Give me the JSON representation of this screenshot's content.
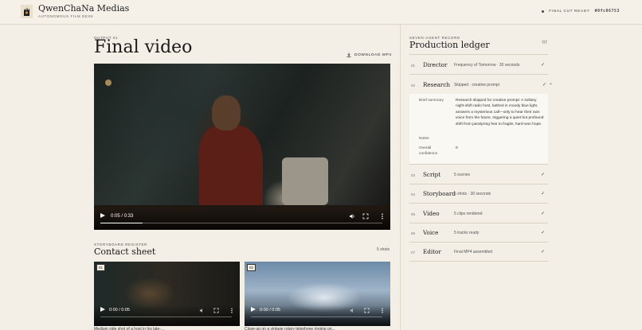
{
  "header": {
    "brand_name": "QwenChaNa Medias",
    "brand_sub": "AUTONOMOUS FILM DESK",
    "status_text": "FINAL CUT READY",
    "status_hash": "#0fc06753"
  },
  "output": {
    "eyebrow": "OUTPUT 01",
    "title": "Final video",
    "download_label": "DOWNLOAD MP4",
    "player": {
      "time": "0:05 / 0:33",
      "progress": 0.15
    }
  },
  "storyboard": {
    "eyebrow": "STORYBOARD REGISTER",
    "title": "Contact sheet",
    "count": "5 shots",
    "thumbs": [
      {
        "num": "01",
        "time": "0:00 / 0:05",
        "caption": "Medium side shot of a host in his late-..."
      },
      {
        "num": "02",
        "time": "0:00 / 0:05",
        "caption": "Close-up on a vintage rotary telephone ringing on..."
      }
    ]
  },
  "ledger": {
    "eyebrow": "SEVEN-AGENT RECORD",
    "title": "Production ledger",
    "count": "7/7",
    "rows": [
      {
        "num": "01",
        "name": "Director",
        "status": "Frequency of Tomorrow · 30 seconds"
      },
      {
        "num": "02",
        "name": "Research",
        "status": "Skipped · creative prompt"
      },
      {
        "num": "03",
        "name": "Script",
        "status": "5 scenes"
      },
      {
        "num": "04",
        "name": "Storyboard",
        "status": "5 shots · 30 seconds"
      },
      {
        "num": "05",
        "name": "Video",
        "status": "5 clips rendered"
      },
      {
        "num": "06",
        "name": "Voice",
        "status": "5 tracks ready"
      },
      {
        "num": "07",
        "name": "Editor",
        "status": "Final MP4 assembled"
      }
    ],
    "detail": {
      "summary_label": "Brief summary",
      "summary_text": "Research skipped for creative prompt: A solitary night-shift radio host, bathed in moody blue light, answers a mysterious call—only to hear their own voice from the future, triggering a quiet but profound shift from paralyzing fear to fragile, hard-won hope.",
      "notes_label": "Notes",
      "confidence_label": "Overall confidence",
      "confidence_value": "0"
    }
  },
  "icons": {
    "check": "✓",
    "chevron_up": "⌃",
    "volume": "speaker-icon",
    "fullscreen": "fullscreen-icon",
    "more": "more-icon"
  }
}
